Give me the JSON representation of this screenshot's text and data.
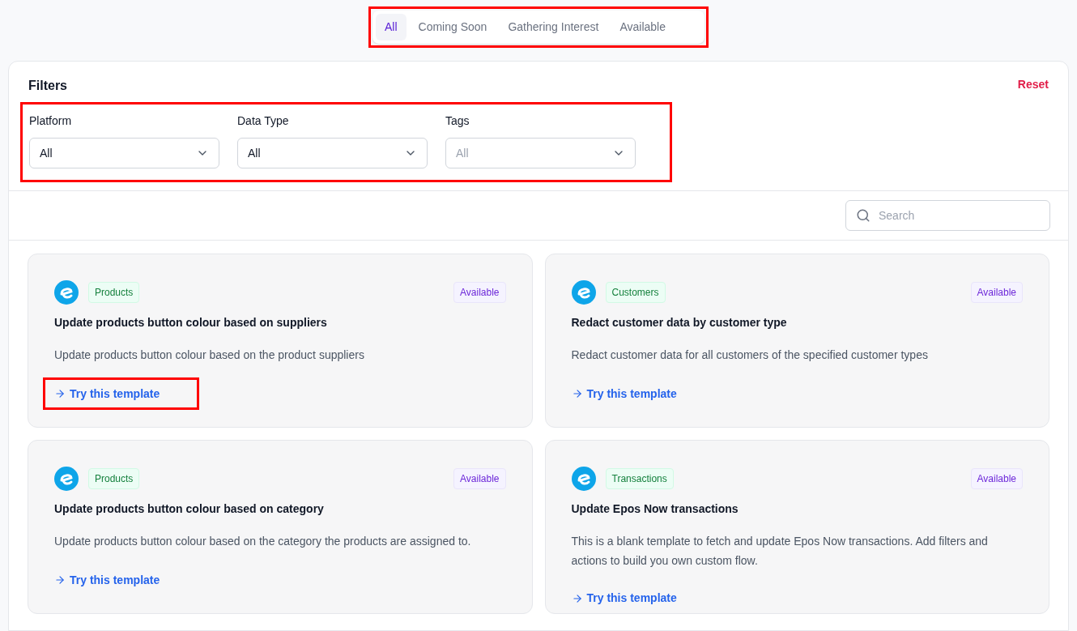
{
  "tabs_bar": {
    "highlighted": true,
    "tabs": [
      {
        "label": "All",
        "selected": true
      },
      {
        "label": "Coming Soon",
        "selected": false
      },
      {
        "label": "Gathering Interest",
        "selected": false
      },
      {
        "label": "Available",
        "selected": false
      }
    ]
  },
  "filters": {
    "title": "Filters",
    "reset": "Reset",
    "highlighted": true,
    "fields": [
      {
        "label": "Platform",
        "value": "All"
      },
      {
        "label": "Data Type",
        "value": "All"
      },
      {
        "label": "Tags",
        "placeholder": "All"
      }
    ]
  },
  "search": {
    "placeholder": "Search"
  },
  "cards": [
    {
      "tag": "Products",
      "status": "Available",
      "title": "Update products button colour based on suppliers",
      "description": "Update products button colour based on the product suppliers",
      "link": "Try this template",
      "highlighted": true
    },
    {
      "tag": "Customers",
      "status": "Available",
      "title": "Redact customer data by customer type",
      "description": "Redact customer data for all customers of the specified customer types",
      "link": "Try this template",
      "highlighted": false
    },
    {
      "tag": "Products",
      "status": "Available",
      "title": "Update products button colour based on category",
      "description": "Update products button colour based on the category the products are assigned to.",
      "link": "Try this template",
      "highlighted": false
    },
    {
      "tag": "Transactions",
      "status": "Available",
      "title": "Update Epos Now transactions",
      "description": "This is a blank template to fetch and update Epos Now transactions. Add filters and actions to build you own custom flow.",
      "link": "Try this template",
      "highlighted": false
    }
  ]
}
